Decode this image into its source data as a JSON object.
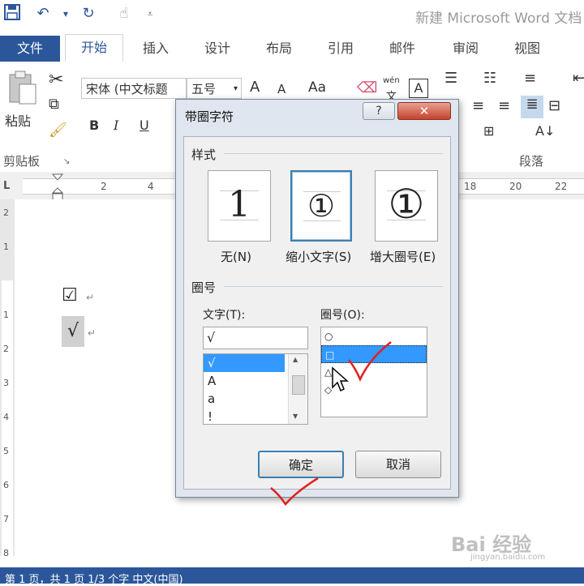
{
  "window": {
    "title": "新建 Microsoft Word 文档"
  },
  "tabs": {
    "file": "文件",
    "items": [
      "开始",
      "插入",
      "设计",
      "布局",
      "引用",
      "邮件",
      "审阅",
      "视图"
    ]
  },
  "ribbon": {
    "paste_label": "粘贴",
    "clipboard_label": "剪贴板",
    "font_name": "宋体 (中文标题",
    "font_size": "五号",
    "grow_font": "A",
    "shrink_font": "A",
    "change_case": "Aa",
    "phonetic_top": "wén",
    "phonetic_bottom": "文",
    "char_border": "A",
    "bold": "B",
    "italic": "I",
    "underline": "U",
    "paragraph_label": "段落"
  },
  "ruler": {
    "h_left": [
      "2",
      "4"
    ],
    "h_right": [
      "18",
      "20",
      "22"
    ],
    "v": [
      "2",
      "1",
      "1",
      "2",
      "3",
      "4",
      "5",
      "6",
      "7",
      "8"
    ]
  },
  "document": {
    "line1": "☑",
    "line2": "√",
    "mark": "↵"
  },
  "dialog": {
    "title": "带圈字符",
    "help": "?",
    "close": "✕",
    "style_section": "样式",
    "styles": [
      {
        "glyph": "1",
        "label": "无(N)"
      },
      {
        "glyph": "①",
        "label": "缩小文字(S)"
      },
      {
        "glyph": "①",
        "label": "增大圈号(E)"
      }
    ],
    "enclosure_section": "圈号",
    "text_label": "文字(T):",
    "text_value": "√",
    "text_items": [
      "√",
      "A",
      "a",
      "!"
    ],
    "enclosure_label": "圈号(O):",
    "enclosure_items": [
      "○",
      "□",
      "△",
      "◇"
    ],
    "ok": "确定",
    "cancel": "取消"
  },
  "status": {
    "text": "第 1 页，共 1 页    1/3 个字    中文(中国)"
  },
  "watermark": {
    "text": "Bai 经验",
    "sub": "jingyan.baidu.com"
  }
}
